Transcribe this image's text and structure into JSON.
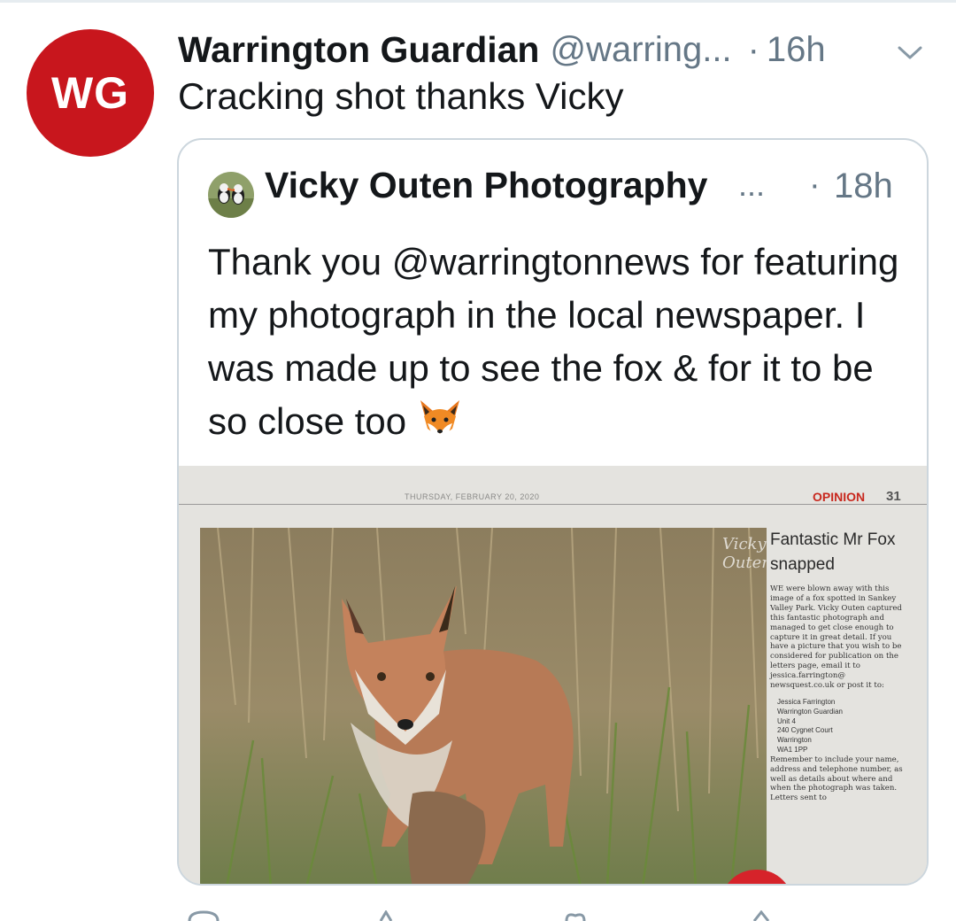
{
  "tweet": {
    "avatar_text": "WG",
    "display_name": "Warrington Guardian",
    "handle": "@warring...",
    "separator": "·",
    "time": "16h",
    "text": "Cracking shot thanks Vicky"
  },
  "quoted_tweet": {
    "display_name": "Vicky Outen Photography",
    "ellipsis": "...",
    "separator": "·",
    "time": "18h",
    "text": "Thank you @warringtonnews for featuring my photograph in the local newspaper. I was made up to see the fox & for it to be so close too"
  },
  "newspaper": {
    "date": "THURSDAY, FEBRUARY 20, 2020",
    "section": "OPINION",
    "page": "31",
    "watermark": "Vicky Outen",
    "headline": "Fantastic Mr Fox snapped",
    "body": "WE were blown away with this image of a fox spotted in Sankey Valley Park. Vicky Outen captured this fantastic photograph and managed to get close enough to capture it in great detail. If you have a picture that you wish to be considered for publication on the letters page, email it to jessica.farrington@ newsquest.co.uk or post it to:",
    "address": [
      "Jessica Farrington",
      "Warrington Guardian",
      "Unit 4",
      "240 Cygnet Court",
      "Warrington",
      "WA1 1PP"
    ],
    "body2": "Remember to include your name, address and telephone number, as well as details about where and when the photograph was taken. Letters sent to"
  },
  "colors": {
    "brand_red": "#c8161d",
    "text_primary": "#14171a",
    "text_secondary": "#657786",
    "border": "#ccd6dd"
  },
  "icons": [
    "chevron-down-icon",
    "fox-emoji-icon",
    "reply-icon",
    "retweet-icon",
    "like-icon",
    "share-icon"
  ]
}
